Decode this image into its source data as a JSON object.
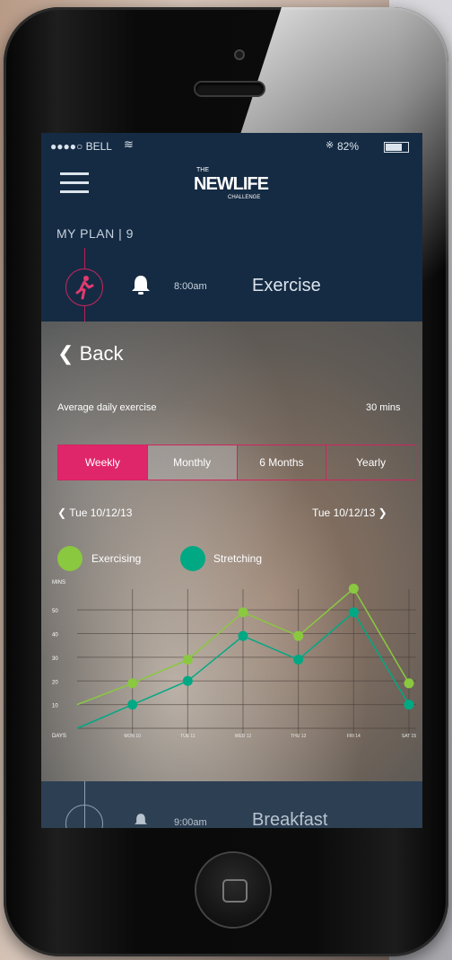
{
  "status_bar": {
    "carrier": "●●●●○ BELL",
    "wifi_icon": "wifi-icon",
    "bluetooth_icon": "bluetooth-icon",
    "battery_percent": "82%",
    "battery_level": 0.82
  },
  "header": {
    "logo_small": "THE",
    "logo_main": "NEWLIFE",
    "logo_sub": "CHALLENGE",
    "section_label": "MY PLAN | 9"
  },
  "current_event": {
    "time": "8:00am",
    "title": "Exercise"
  },
  "detail": {
    "back_label": "Back",
    "avg_label": "Average daily exercise",
    "avg_value": "30 mins",
    "tabs": [
      {
        "label": "Weekly",
        "active": true
      },
      {
        "label": "Monthly",
        "active": false
      },
      {
        "label": "6 Months",
        "active": false
      },
      {
        "label": "Yearly",
        "active": false
      }
    ],
    "date_start": "Tue 10/12/13",
    "date_end": "Tue 10/12/13",
    "legend": [
      {
        "label": "Exercising",
        "color": "#8ac840"
      },
      {
        "label": "Stretching",
        "color": "#00a884"
      }
    ]
  },
  "chart_data": {
    "type": "line",
    "ylabel": "MINS",
    "xlabel": "DAYS",
    "y_ticks": [
      "50",
      "40",
      "30",
      "20",
      "10"
    ],
    "ylim": [
      0,
      55
    ],
    "x": [
      "MON 10",
      "TUE 11",
      "WED 12",
      "THU 13",
      "FRI 14",
      "SAT 15"
    ],
    "grid": true,
    "series": [
      {
        "name": "Exercising",
        "color": "#8ac840",
        "values": [
          10,
          19,
          29,
          49,
          39,
          59,
          19
        ]
      },
      {
        "name": "Stretching",
        "color": "#00a884",
        "values": [
          0,
          10,
          20,
          39,
          29,
          49,
          10
        ]
      }
    ]
  },
  "next_event": {
    "time": "9:00am",
    "title": "Breakfast"
  }
}
